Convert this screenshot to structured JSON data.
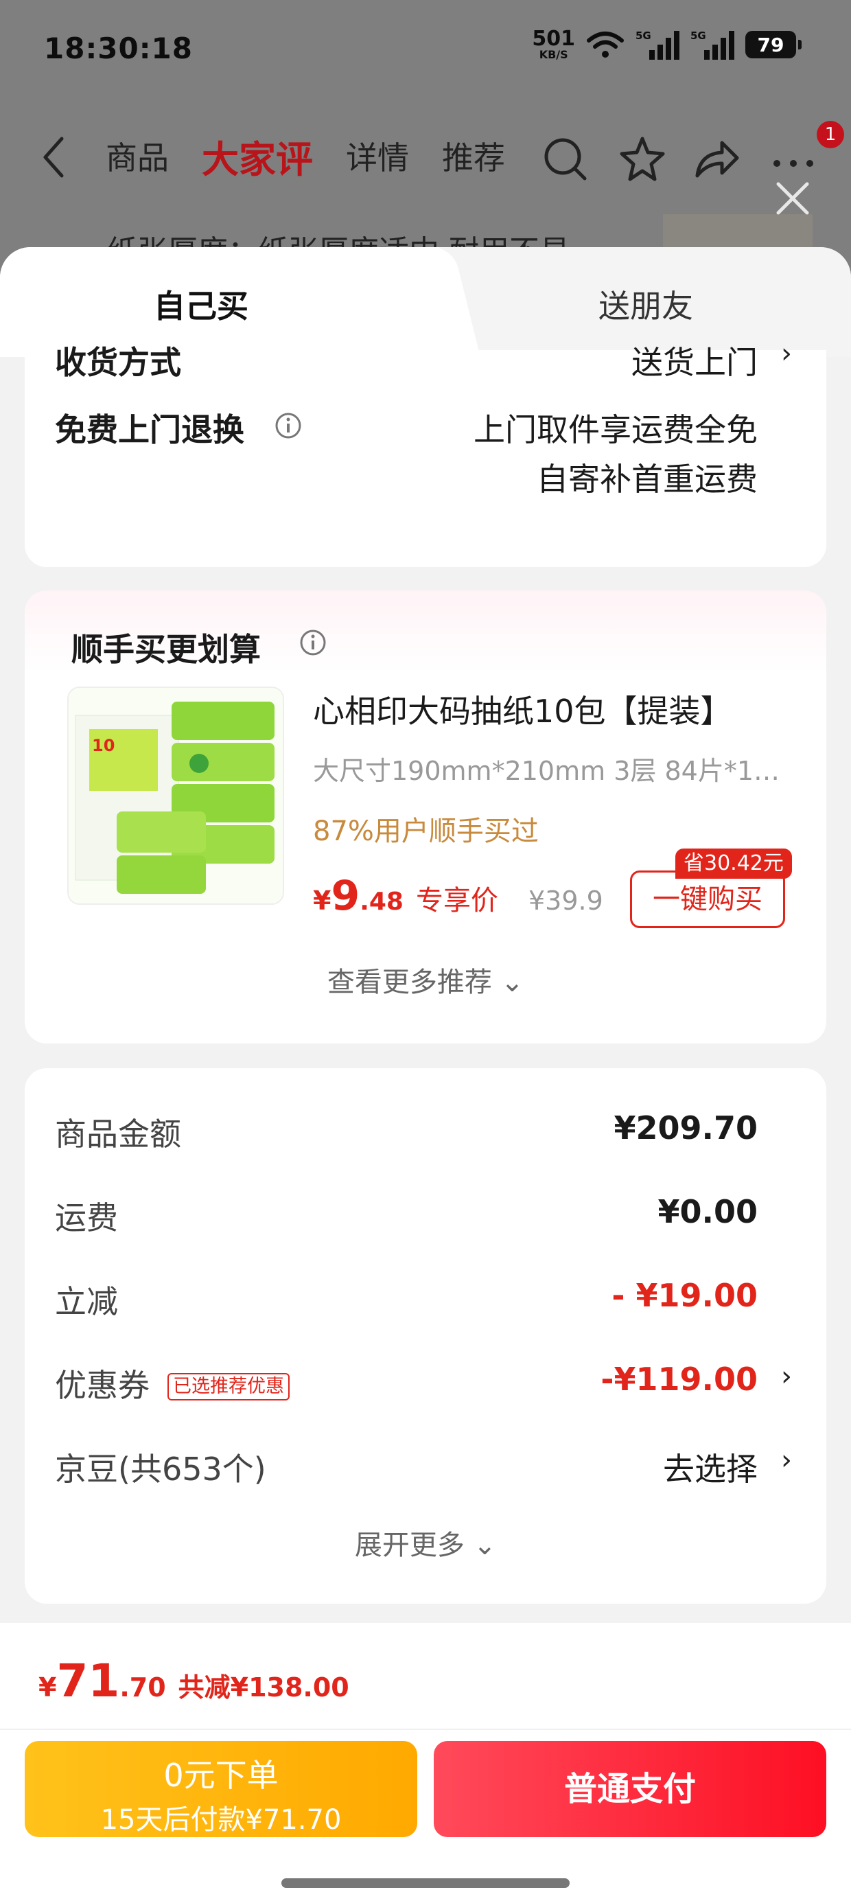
{
  "status_bar": {
    "time": "18:30:18",
    "net_speed_value": "501",
    "net_speed_unit": "KB/S",
    "signal_1_label": "5G",
    "signal_2_label": "5G",
    "battery": "79"
  },
  "nav": {
    "tabs": [
      "商品",
      "大家评",
      "详情",
      "推荐"
    ],
    "active_tab": "大家评",
    "badge_count": "1",
    "background_text": "纸张厚度：纸张厚度适中 耐用不易"
  },
  "sheet": {
    "tabs": {
      "own": "自己买",
      "gift": "送朋友"
    },
    "shipping": {
      "method_label": "收货方式",
      "method_value": "送货上门",
      "return_label": "免费上门退换",
      "return_line1": "上门取件享运费全免",
      "return_line2": "自寄补首重运费"
    },
    "recommend": {
      "title": "顺手买更划算",
      "product_title": "心相印大码抽纸10包【提装】",
      "product_spec": "大尺寸190mm*210mm 3层 84片*10...",
      "buy_percent": "87%用户顺手买过",
      "price_currency": "¥",
      "price_int": "9",
      "price_dec": ".48",
      "price_tag": "专享价",
      "original_price": "¥39.9",
      "save_tag": "省30.42元",
      "buy_button": "一键购买",
      "more": "查看更多推荐 ⌄"
    },
    "summary": {
      "rows": [
        {
          "label": "商品金额",
          "value": "¥209.70"
        },
        {
          "label": "运费",
          "value": "¥0.00"
        },
        {
          "label": "立减",
          "value": "- ¥19.00"
        },
        {
          "label": "优惠券",
          "value": "-¥119.00"
        },
        {
          "label": "京豆(共653个)",
          "value": "去选择"
        }
      ],
      "coupon_badge": "已选推荐优惠",
      "expand_more": "展开更多 ⌄"
    }
  },
  "bottom": {
    "total_currency": "¥",
    "total_int": "71",
    "total_dec": ".70",
    "total_saved": "共减¥138.00",
    "later_pay_line1": "0元下单",
    "later_pay_line2": "15天后付款¥71.70",
    "pay_button": "普通支付"
  },
  "colors": {
    "accent_red": "#e1251b",
    "pay_button": "#fe0f23",
    "later_button": "#ffb300"
  }
}
